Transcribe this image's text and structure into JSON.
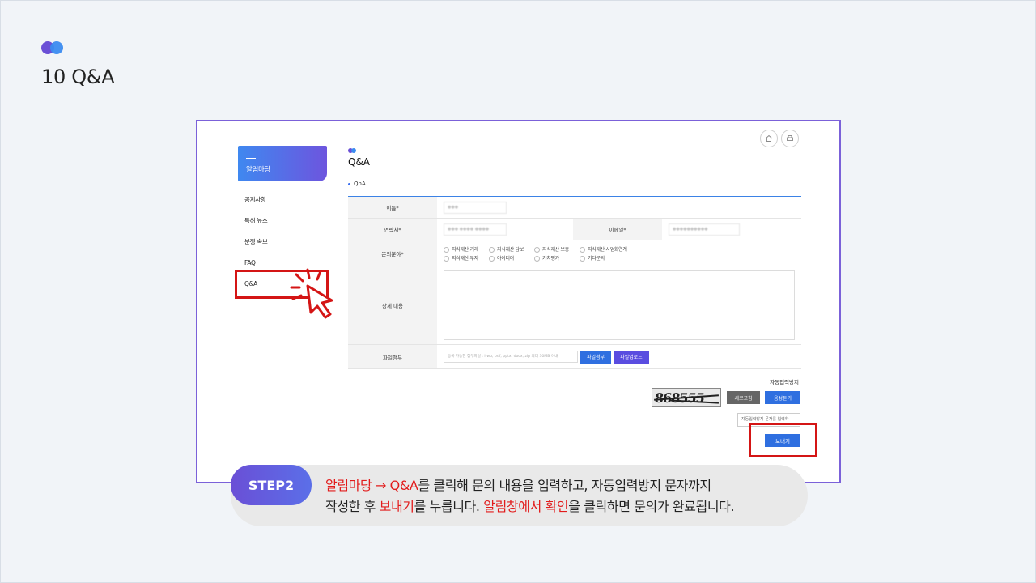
{
  "slide": {
    "title": "10 Q&A"
  },
  "sidebar": {
    "header": "알림마당",
    "items": [
      {
        "label": "공지사항"
      },
      {
        "label": "특허 뉴스"
      },
      {
        "label": "분쟁 속보"
      },
      {
        "label": "FAQ"
      },
      {
        "label": "Q&A"
      }
    ]
  },
  "header_icons": [
    "home-icon",
    "print-icon"
  ],
  "main": {
    "title": "Q&A",
    "section": "QnA",
    "fields": {
      "name_label": "이름*",
      "contact_label": "연락처*",
      "email_label": "이메일*",
      "category_label": "문의분야*",
      "detail_label": "상세 내용",
      "file_label": "파일첨부"
    },
    "categories": [
      "지식재산 거래",
      "지식재산 담보",
      "지식재산 보증",
      "지식재산 사업화연계",
      "지식재산 투자",
      "아이디어",
      "가치평가",
      "기타문의"
    ],
    "file_placeholder": "등록 가능한 첨부파일 : hwp, pdf, pptx, docx, zip 최대 30MB 이내",
    "file_info_button": "파일첨부",
    "file_upload_button": "파일업로드",
    "captcha_title": "자동입력방지",
    "captcha_text": "868555",
    "refresh_button": "새로고침",
    "audio_button": "음성듣기",
    "captcha_placeholder": "자동입력방지 문자를 입력하",
    "send_button": "보내기"
  },
  "step": {
    "label": "STEP2",
    "line1": {
      "hl1": "알림마당 → Q&A",
      "t1": "를 클릭해 문의 내용을 입력하고, 자동입력방지 문자까지"
    },
    "line2": {
      "t1": "작성한 후 ",
      "hl1": "보내기",
      "t2": "를 누릅니다. ",
      "hl2": "알림창에서 확인",
      "t3": "을 클릭하면 문의가 완료됩니다."
    }
  },
  "colors": {
    "accent_purple": "#6a4fd6",
    "accent_blue": "#3b8bf0",
    "highlight_red": "#e21b1b",
    "button_blue": "#2f6fe0"
  }
}
